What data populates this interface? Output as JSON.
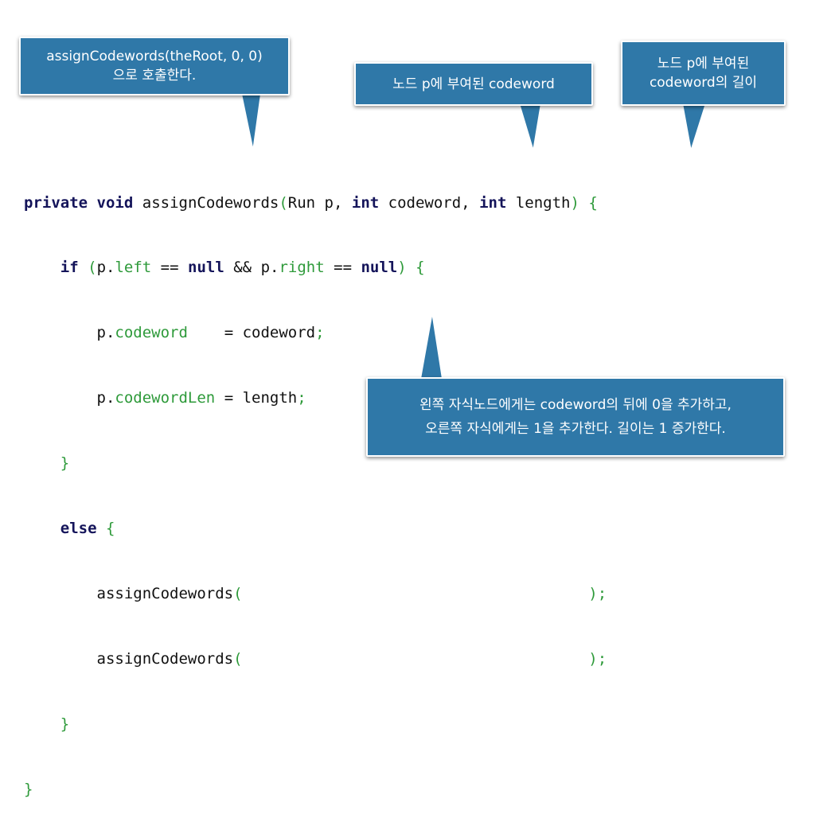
{
  "callouts": {
    "call_note": [
      "assignCodewords(theRoot, 0, 0)",
      "으로 호출한다."
    ],
    "codeword_note": [
      "노드 p에 부여된 codeword"
    ],
    "length_note": [
      "노드 p에 부여된",
      "codeword의 길이"
    ],
    "children_note": [
      "왼쪽 자식노드에게는 codeword의 뒤에 0을 추가하고,",
      "오른쪽 자식에게는 1을 추가한다. 길이는 1 증가한다."
    ]
  },
  "code": {
    "l1": {
      "kw_private": "private",
      "kw_void": "void",
      "method": "assignCodewords",
      "paren_open": "(",
      "p1_type": "Run p,",
      "kw_int1": "int",
      "p2_name": "codeword,",
      "kw_int2": "int",
      "p3_name": "length",
      "close": ") {"
    },
    "l2": {
      "kw_if": "if",
      "paren": "(",
      "obj1": "p.",
      "fld_left": "left",
      "eq1": "==",
      "kw_null1": "null",
      "and": "&&",
      "obj2": "p.",
      "fld_right": "right",
      "eq2": "==",
      "kw_null2": "null",
      "close": ") {"
    },
    "l3": {
      "obj": "p.",
      "fld": "codeword",
      "rhs": "= codeword",
      "semi": ";"
    },
    "l4": {
      "obj": "p.",
      "fld": "codewordLen",
      "rhs": "= length",
      "semi": ";"
    },
    "l5": {
      "brace": "}"
    },
    "l6": {
      "kw_else": "else",
      "brace": "{"
    },
    "l7": {
      "call": "assignCodewords",
      "open": "(",
      "close": ");"
    },
    "l8": {
      "call": "assignCodewords",
      "open": "(",
      "close": ");"
    },
    "l9": {
      "brace": "}"
    },
    "l10": {
      "brace": "}"
    }
  }
}
